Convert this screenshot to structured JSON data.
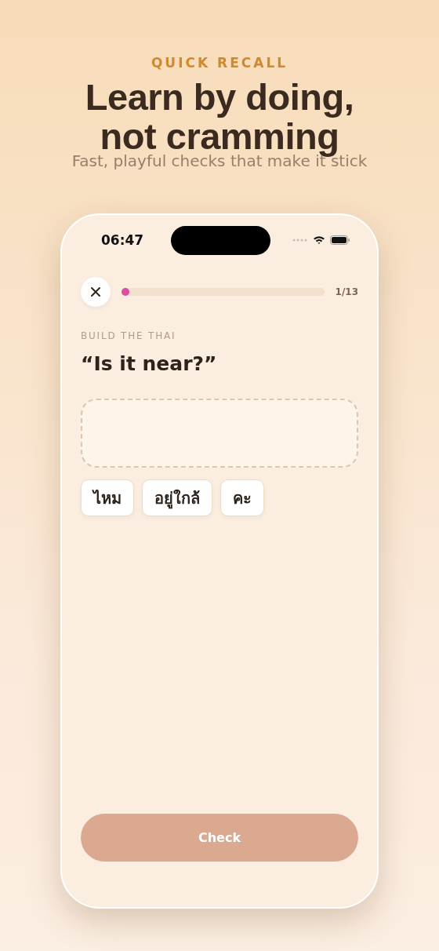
{
  "header": {
    "eyebrow": "QUICK RECALL",
    "title_lines": [
      "Learn by doing,",
      "not cramming"
    ],
    "subtitle": "Fast, playful checks that make it stick"
  },
  "status_bar": {
    "time": "06:47"
  },
  "lesson": {
    "progress": {
      "level": 0.04,
      "counter": "1/13"
    },
    "instruction": "BUILD THE THAI",
    "prompt": "“Is it near?”",
    "word_tiles": [
      {
        "text": "ไหม"
      },
      {
        "text": "อยู่ใกล้"
      },
      {
        "text": "คะ"
      }
    ],
    "check_button": {
      "label": "Check",
      "disabled": true
    }
  }
}
